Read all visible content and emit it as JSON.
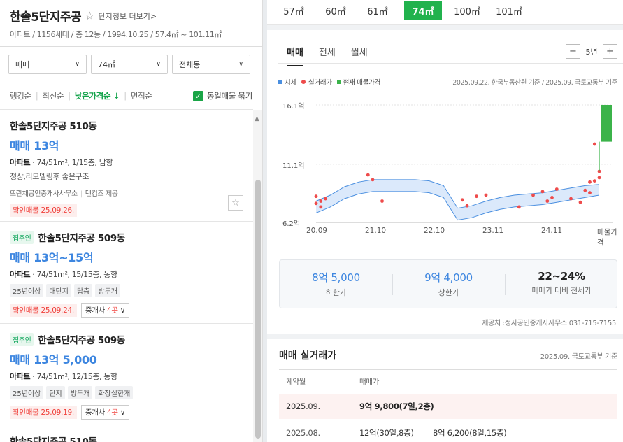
{
  "complex": {
    "name": "한솔5단지주공",
    "star": "☆",
    "info_link": "단지정보 더보기",
    "info_chevron": ">",
    "summary": "아파트 / 1156세대 / 총 12동 / 1994.10.25 / 57.4㎡ ~ 101.11㎡"
  },
  "filters": [
    {
      "label": "매매",
      "chevron": "∨"
    },
    {
      "label": "74㎡",
      "chevron": "∨"
    },
    {
      "label": "전체동",
      "chevron": "∨"
    }
  ],
  "sorts": {
    "items": [
      "랭킹순",
      "최신순",
      "낮은가격순 ↓",
      "면적순"
    ],
    "active_index": 2,
    "group_same": "동일매물 묶기",
    "group_checked": "✓"
  },
  "listings": [
    {
      "building": "한솔5단지주공 510동",
      "owner_badge": "",
      "price": "매매 13억",
      "spec_type": "아파트",
      "spec_detail": " · 74/51m², 1/15층, 남향",
      "desc": "정상,리모델링후 좋은구조",
      "agent": "뜨란채공인중개사사무소",
      "agent_extra": "텐컴즈 제공",
      "tags": [],
      "confirmed": "확인매물 25.09.26.",
      "agents_btn": "",
      "fav": "☆"
    },
    {
      "building": "한솔5단지주공 509동",
      "owner_badge": "집주인",
      "price": "매매 13억~15억",
      "spec_type": "아파트",
      "spec_detail": " · 74/51m², 15/15층, 동향",
      "desc": "",
      "agent": "",
      "agent_extra": "",
      "tags": [
        "25년이상",
        "대단지",
        "탑층",
        "방두개"
      ],
      "confirmed": "확인매물 25.09.24.",
      "agents_btn_prefix": "중개사 ",
      "agents_btn_count": "4곳",
      "agents_btn_chev": "∨"
    },
    {
      "building": "한솔5단지주공 509동",
      "owner_badge": "집주인",
      "price": "매매 13억 5,000",
      "spec_type": "아파트",
      "spec_detail": " · 74/51m², 12/15층, 동향",
      "desc": "",
      "agent": "",
      "agent_extra": "",
      "tags": [
        "25년이상",
        "단지",
        "방두개",
        "화장실한개"
      ],
      "confirmed": "확인매물 25.09.19.",
      "agents_btn_prefix": "중개사 ",
      "agents_btn_count": "4곳",
      "agents_btn_chev": "∨"
    },
    {
      "building": "한솔5단지주공 510동"
    }
  ],
  "scroll_up": "▲",
  "area_tabs": {
    "items": [
      "57㎡",
      "60㎡",
      "61㎡",
      "74㎡",
      "100㎡",
      "101㎡"
    ],
    "active_index": 3
  },
  "trade_tabs": {
    "items": [
      "매매",
      "전세",
      "월세"
    ],
    "active_index": 0
  },
  "zoom": {
    "minus": "−",
    "label": "5년",
    "plus": "+"
  },
  "legend": {
    "items": [
      "시세",
      "실거래가",
      "현재 매물가격"
    ],
    "source": "2025.09.22. 한국부동산원 기준 / 2025.09. 국토교통부 기준"
  },
  "chart_data": {
    "type": "line",
    "y_unit": "억",
    "y_ticks": [
      "16.1억",
      "11.1억",
      "6.2억"
    ],
    "y_tick_values": [
      16.1,
      11.1,
      6.2
    ],
    "x_ticks": [
      "20.09",
      "21.10",
      "22.10",
      "23.11",
      "24.11",
      "매물가격"
    ],
    "ylim": [
      6.2,
      16.1
    ],
    "grid": true,
    "series": [
      {
        "name": "시세",
        "color": "#4a8fe0",
        "x": [
          "2020.09",
          "2020.12",
          "2021.03",
          "2021.06",
          "2021.09",
          "2021.12",
          "2022.03",
          "2022.06",
          "2022.09",
          "2022.12",
          "2023.03",
          "2023.06",
          "2023.09",
          "2023.12",
          "2024.03",
          "2024.06",
          "2024.09",
          "2024.12",
          "2025.03",
          "2025.06",
          "2025.09"
        ],
        "low": [
          7.0,
          7.5,
          8.2,
          8.6,
          8.8,
          8.8,
          8.8,
          8.8,
          8.7,
          8.3,
          6.4,
          6.6,
          7.0,
          7.3,
          7.5,
          7.6,
          7.7,
          7.9,
          8.1,
          8.3,
          8.5
        ],
        "high": [
          8.0,
          8.5,
          9.2,
          9.6,
          9.8,
          9.8,
          9.8,
          9.8,
          9.7,
          9.3,
          7.4,
          7.6,
          8.0,
          8.3,
          8.5,
          8.6,
          8.7,
          8.9,
          9.1,
          9.3,
          9.4
        ]
      },
      {
        "name": "실거래가",
        "color": "#ee4b4b",
        "points": [
          [
            "2020.09",
            7.8
          ],
          [
            "2020.09",
            8.4
          ],
          [
            "2020.10",
            7.5
          ],
          [
            "2020.10",
            8.0
          ],
          [
            "2020.11",
            8.2
          ],
          [
            "2021.08",
            10.2
          ],
          [
            "2021.09",
            9.8
          ],
          [
            "2021.11",
            8.0
          ],
          [
            "2023.04",
            8.1
          ],
          [
            "2023.05",
            7.6
          ],
          [
            "2023.07",
            8.4
          ],
          [
            "2023.09",
            8.5
          ],
          [
            "2024.04",
            7.5
          ],
          [
            "2024.07",
            8.5
          ],
          [
            "2024.09",
            8.8
          ],
          [
            "2024.10",
            8.0
          ],
          [
            "2024.11",
            8.3
          ],
          [
            "2024.12",
            9.0
          ],
          [
            "2025.03",
            8.2
          ],
          [
            "2025.05",
            7.9
          ],
          [
            "2025.06",
            8.9
          ],
          [
            "2025.07",
            9.6
          ],
          [
            "2025.07",
            8.7
          ],
          [
            "2025.08",
            9.7
          ],
          [
            "2025.08",
            12.8
          ],
          [
            "2025.09",
            9.98
          ],
          [
            "2025.09",
            10.5
          ]
        ]
      },
      {
        "name": "현재 매물가격",
        "color": "#3bb34a",
        "range": [
          13.0,
          16.1
        ]
      }
    ]
  },
  "range_summary": {
    "low_value": "8억 5,000",
    "low_label": "하한가",
    "high_value": "9억 4,000",
    "high_label": "상한가",
    "ratio_value": "22~24%",
    "ratio_label": "매매가 대비 전세가"
  },
  "provider": "제공처 :정자공인중개사사무소 031-715-7155",
  "real_trades": {
    "title": "매매 실거래가",
    "note": "2025.09. 국토교통부 기준",
    "headers": [
      "계약월",
      "매매가"
    ],
    "rows": [
      {
        "month": "2025.09.",
        "deal1": "9억 9,800(7일,2층)",
        "deal2": ""
      },
      {
        "month": "2025.08.",
        "deal1": "12억(30일,8층)",
        "deal2": "8억 6,200(8일,15층)"
      }
    ]
  }
}
